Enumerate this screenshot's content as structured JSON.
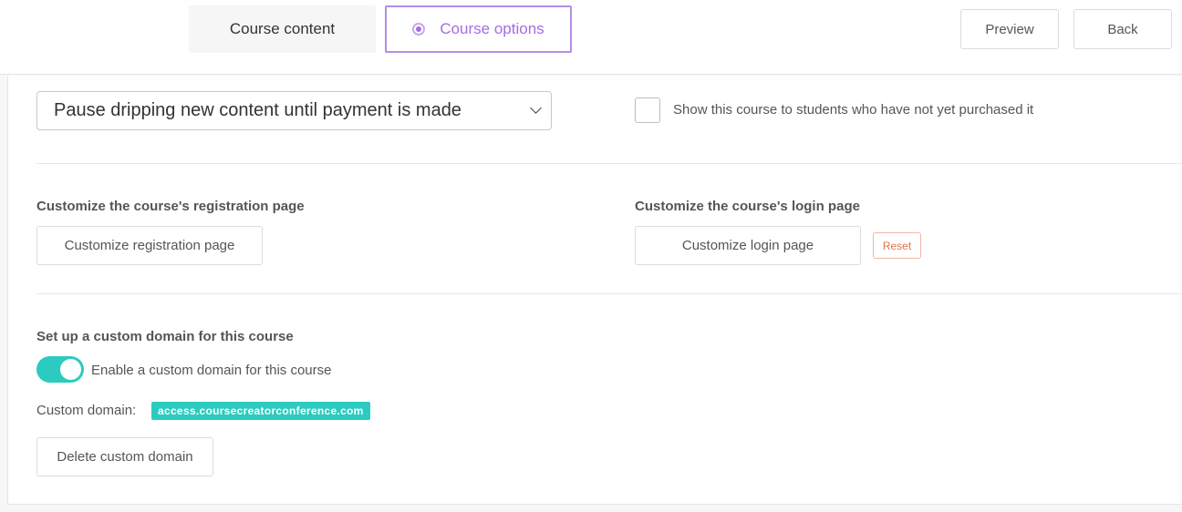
{
  "header": {
    "tabs": [
      {
        "label": "Course content",
        "active": false
      },
      {
        "label": "Course options",
        "active": true
      }
    ],
    "preview_label": "Preview",
    "back_label": "Back"
  },
  "drip": {
    "selected_option": "Pause dripping new content until payment is made"
  },
  "visibility": {
    "checkbox_label": "Show this course to students who have not yet purchased it",
    "checked": false
  },
  "registration": {
    "heading": "Customize the course's registration page",
    "button_label": "Customize registration page"
  },
  "login": {
    "heading": "Customize the course's login page",
    "button_label": "Customize login page",
    "reset_label": "Reset"
  },
  "custom_domain": {
    "heading": "Set up a custom domain for this course",
    "toggle_label": "Enable a custom domain for this course",
    "enabled": true,
    "domain_label": "Custom domain:",
    "domain_value": "access.coursecreatorconference.com",
    "delete_label": "Delete custom domain"
  },
  "colors": {
    "accent_purple": "#a36ee0",
    "accent_teal": "#2ccbc0",
    "reset_orange": "#e0734a"
  }
}
